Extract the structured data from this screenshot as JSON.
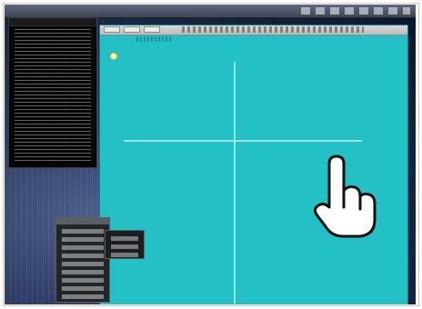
{
  "screen": {
    "desktop_bg_color": "#17223f",
    "accent_window_bg": "#23c0c6",
    "crosshair_color": "#9ee8e9"
  },
  "windows": {
    "terminal": {
      "visible_text": ""
    },
    "main": {
      "title": ""
    }
  },
  "icons": {
    "cursor": "hand-pointer-icon",
    "mini": "small-icon"
  },
  "menus": {
    "panel": {
      "items": [
        "",
        "",
        "",
        "",
        "",
        "",
        "",
        "",
        ""
      ]
    },
    "subpanel": {
      "items": [
        "",
        "",
        ""
      ]
    }
  }
}
